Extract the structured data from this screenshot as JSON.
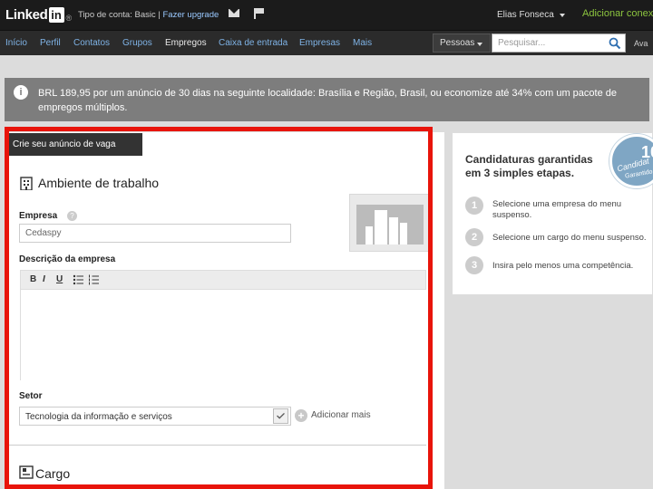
{
  "topbar": {
    "logo_text": "Linked",
    "logo_in": "in",
    "logo_sup": "®",
    "account_type": "Tipo de conta: Basic | ",
    "upgrade_link": "Fazer upgrade",
    "user_name": "Elias Fonseca",
    "add_contacts": "Adicionar conex"
  },
  "nav": {
    "items": [
      "Início",
      "Perfil",
      "Contatos",
      "Grupos",
      "Empregos",
      "Caixa de entrada",
      "Empresas",
      "Mais"
    ],
    "search_type": "Pessoas",
    "search_placeholder": "Pesquisar...",
    "advanced": "Ava"
  },
  "banner": {
    "text": "BRL 189,95 por um anúncio de 30 dias na seguinte localidade: Brasília e Região, Brasil, ou economize até 34% com um pacote de empregos múltiplos."
  },
  "form": {
    "tab_label": "Crie seu anúncio de vaga",
    "section_workplace": "Ambiente de trabalho",
    "company_label": "Empresa",
    "company_value": "Cedaspy",
    "description_label": "Descrição da empresa",
    "toolbar": {
      "bold": "B",
      "italic": "I",
      "underline": "U"
    },
    "sector_label": "Setor",
    "sector_value": "Tecnologia da informação e serviços",
    "add_more": "Adicionar mais",
    "section_job": "Cargo"
  },
  "side": {
    "title": "Candidaturas garantidas em 3 simples etapas.",
    "steps": [
      {
        "num": "1",
        "text": "Selecione uma empresa do menu suspenso."
      },
      {
        "num": "2",
        "text": "Selecione um cargo do menu suspenso."
      },
      {
        "num": "3",
        "text": "Insira pelo menos uma competência."
      }
    ],
    "badge_num": "10",
    "badge_line": "Candidat",
    "badge_sub": "Garantido"
  },
  "colors": {
    "highlight": "#e8140a",
    "link": "#7fb3e6",
    "add_contacts": "#8dc63f"
  }
}
